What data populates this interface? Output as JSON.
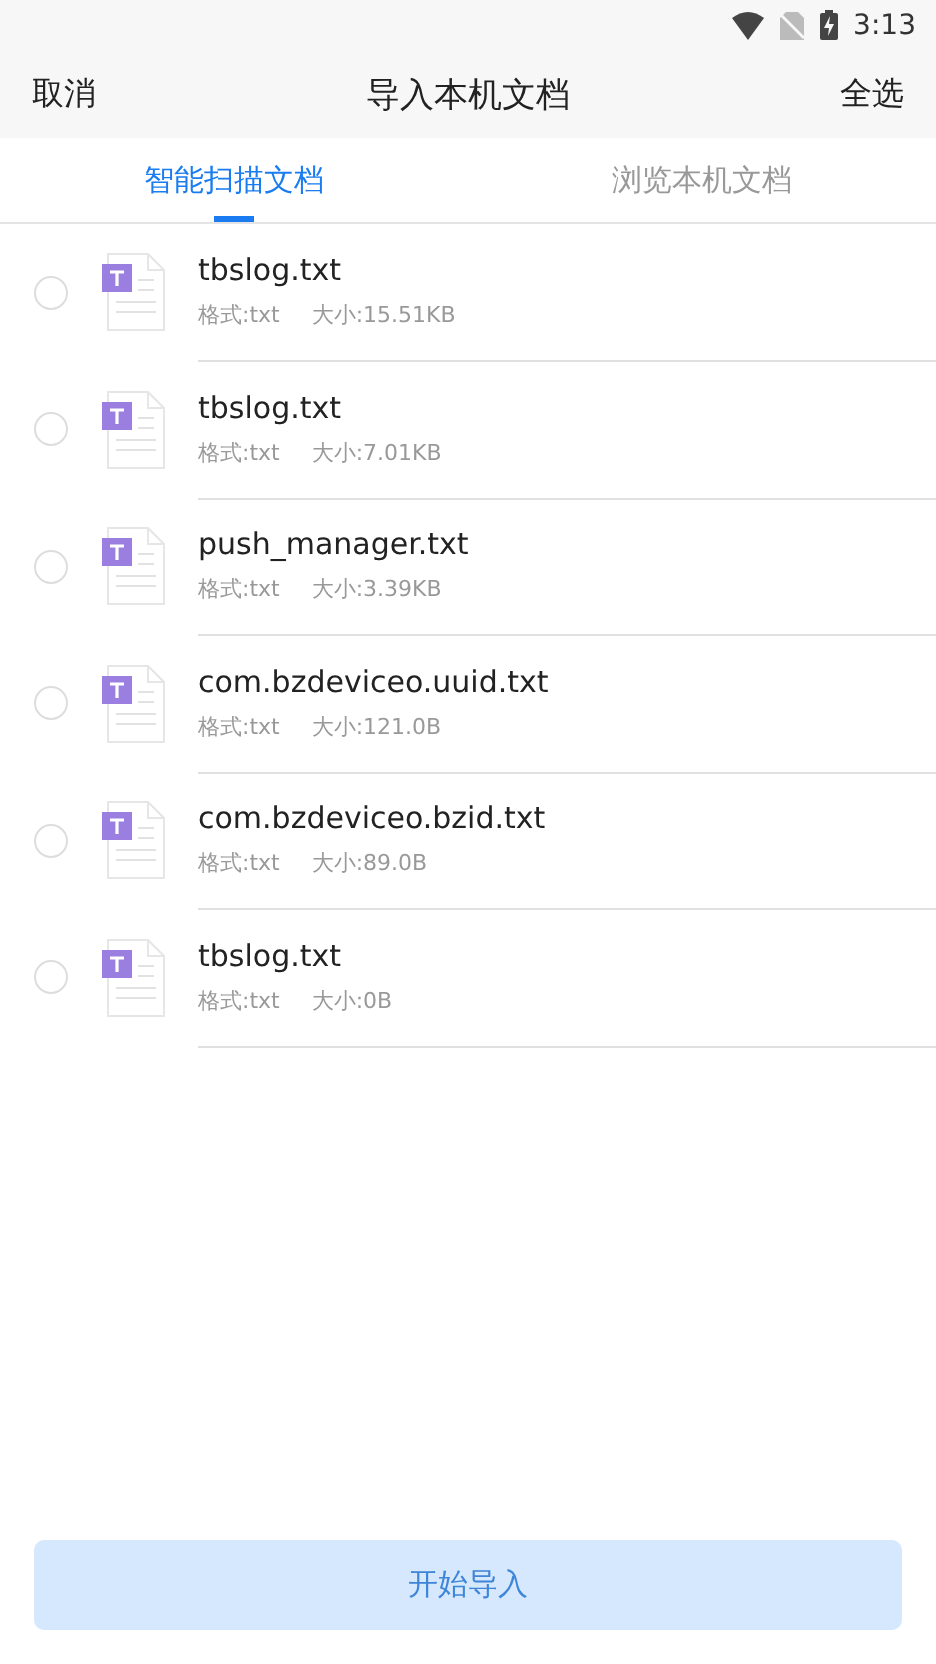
{
  "status_bar": {
    "time": "3:13"
  },
  "header": {
    "cancel": "取消",
    "title": "导入本机文档",
    "select_all": "全选"
  },
  "tabs": [
    {
      "label": "智能扫描文档",
      "selected": true
    },
    {
      "label": "浏览本机文档",
      "selected": false
    }
  ],
  "files": [
    {
      "name": "tbslog.txt",
      "format": "格式:txt",
      "size": "大小:15.51KB",
      "selected": false
    },
    {
      "name": "tbslog.txt",
      "format": "格式:txt",
      "size": "大小:7.01KB",
      "selected": false
    },
    {
      "name": "push_manager.txt",
      "format": "格式:txt",
      "size": "大小:3.39KB",
      "selected": false
    },
    {
      "name": "com.bzdeviceo.uuid.txt",
      "format": "格式:txt",
      "size": "大小:121.0B",
      "selected": false
    },
    {
      "name": "com.bzdeviceo.bzid.txt",
      "format": "格式:txt",
      "size": "大小:89.0B",
      "selected": false
    },
    {
      "name": "tbslog.txt",
      "format": "格式:txt",
      "size": "大小:0B",
      "selected": false
    }
  ],
  "import_button": {
    "label": "开始导入",
    "disabled": true
  }
}
